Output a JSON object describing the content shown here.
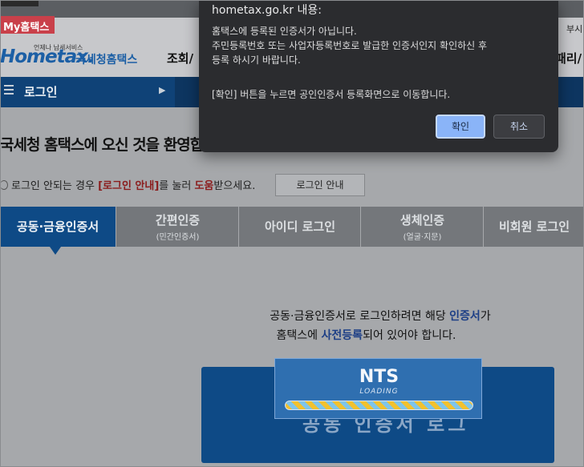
{
  "header": {
    "my_hometax": "My홈택스",
    "logo_small": "언제나 납세서비스",
    "logo_text": "Hometax.",
    "logo_kor": "국세청홈택스",
    "nav_cut_left": "조회/",
    "nav_cut_right": "패리/",
    "corner_text": "부시"
  },
  "login_bar": {
    "label": "로그인"
  },
  "welcome": "국세청 홈택스에 오신 것을 환영합",
  "help": {
    "pre": "로그인 안되는 경우 ",
    "link": "[로그인 안내]",
    "mid": "를 눌러 ",
    "hl": "도움",
    "post": "받으세요.",
    "button": "로그인 안내"
  },
  "tabs": [
    {
      "label": "공동·금융인증서",
      "sub": ""
    },
    {
      "label": "간편인증",
      "sub": "(민간인증서)"
    },
    {
      "label": "아이디 로그인",
      "sub": ""
    },
    {
      "label": "생체인증",
      "sub": "(얼굴·지문)"
    },
    {
      "label": "비회원 로그인",
      "sub": ""
    }
  ],
  "info": {
    "line1_pre": "공동·금융인증서로 로그인하려면 해당 ",
    "line1_blue": "인증서",
    "line1_post": "가",
    "line2_pre": "홈택스에 ",
    "line2_blue": "사전등록",
    "line2_post": "되어 있어야 합니다."
  },
  "bigbox_text": "공동 인증서 로그",
  "loading": {
    "title": "NTS",
    "sub": "LOADING"
  },
  "dialog": {
    "title": "hometax.go.kr 내용:",
    "line1": "홈택스에 등록된 인증서가 아닙니다.",
    "line2": "주민등록번호 또는 사업자등록번호로 발급한 인증서인지 확인하신 후",
    "line3": "등록 하시기 바랍니다.",
    "line4": "[확인] 버튼을 누르면 공인인증서 등록화면으로 이동합니다.",
    "ok": "확인",
    "cancel": "취소"
  }
}
